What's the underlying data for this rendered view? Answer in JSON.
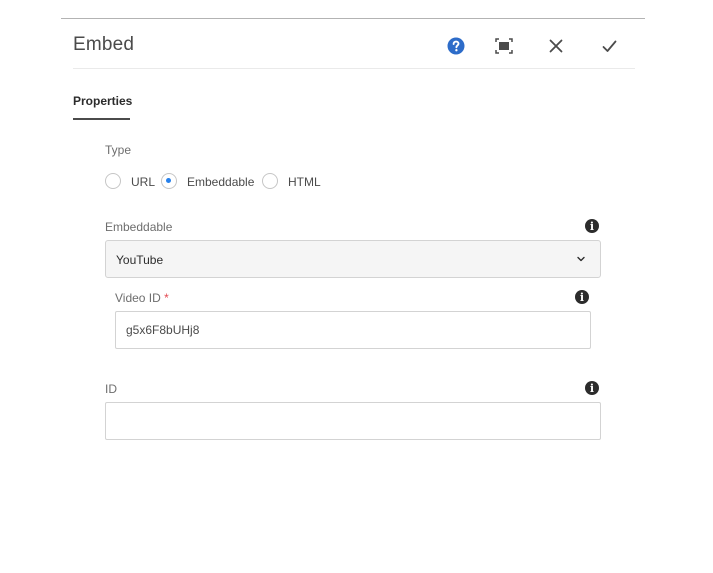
{
  "dialog": {
    "title": "Embed",
    "toolbar": {
      "help_icon": "help-circle-icon",
      "fullscreen_icon": "fullscreen-icon",
      "close_icon": "close-icon",
      "done_icon": "checkmark-icon"
    }
  },
  "tabs": [
    {
      "label": "Properties",
      "selected": true
    }
  ],
  "type_field": {
    "label": "Type",
    "options": [
      {
        "label": "URL",
        "checked": false
      },
      {
        "label": "Embeddable",
        "checked": true
      },
      {
        "label": "HTML",
        "checked": false
      }
    ]
  },
  "embeddable_field": {
    "label": "Embeddable",
    "selected_value": "YouTube"
  },
  "video_id_field": {
    "label": "Video ID",
    "required_mark": "*",
    "value": "g5x6F8bUHj8"
  },
  "id_field": {
    "label": "ID",
    "value": ""
  },
  "colors": {
    "accent": "#2680eb",
    "help_icon": "#2d6cc9",
    "required": "#e34850"
  }
}
